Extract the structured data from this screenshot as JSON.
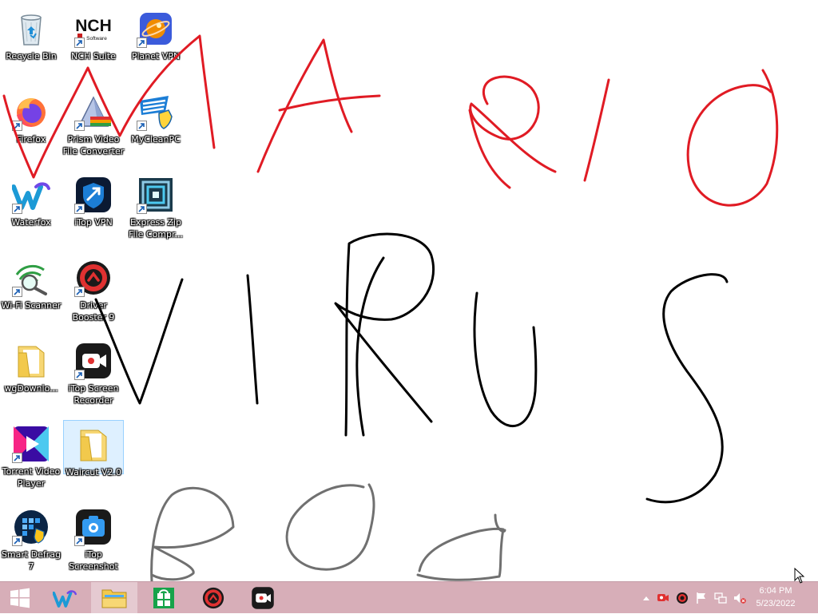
{
  "desktop": {
    "icons": [
      {
        "label": "Recycle Bin"
      },
      {
        "label": "NCH Suite",
        "badge_text": "NCH",
        "badge_sub": "Software"
      },
      {
        "label": "Planet VPN"
      },
      {
        "label": "Firefox"
      },
      {
        "label": "Prism Video File Converter"
      },
      {
        "label": "MyCleanPC"
      },
      {
        "label": "Waterfox"
      },
      {
        "label": "iTop VPN"
      },
      {
        "label": "Express Zip File Compr..."
      },
      {
        "label": "Wi-Fi Scanner"
      },
      {
        "label": "Driver Booster 9"
      },
      {
        "label": "wgDownlo..."
      },
      {
        "label": "iTop Screen Recorder"
      },
      {
        "label": "Torrent Video Player"
      },
      {
        "label": "Waircut V2.0"
      },
      {
        "label": "Smart Defrag 7"
      },
      {
        "label": "iTop Screenshot"
      }
    ],
    "selected_icon": "Waircut V2.0",
    "drawing_colors": {
      "red": "#e01b24",
      "black": "#000000",
      "gray": "#707070"
    }
  },
  "taskbar": {
    "background": "#d7aeb8",
    "pinned": [
      "start",
      "waterfox",
      "file-explorer",
      "store",
      "driver-booster",
      "itop-screen-recorder"
    ],
    "clock": {
      "time": "6:04 PM",
      "date": "5/23/2022"
    }
  }
}
